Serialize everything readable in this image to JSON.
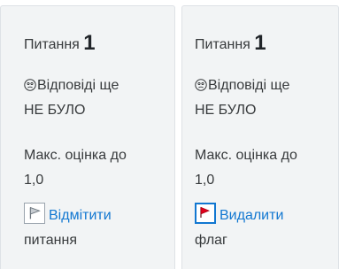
{
  "cards": [
    {
      "title_prefix": "Питання",
      "number": "1",
      "status_line1": "Відповіді ще",
      "status_line2": "НЕ БУЛО",
      "grade_line1": "Макс. оцінка до",
      "grade_line2": "1,0",
      "flag_line1": "Відмітити",
      "flag_line2": "питання",
      "flag_icon": "flag-outline-icon"
    },
    {
      "title_prefix": "Питання",
      "number": "1",
      "status_line1": "Відповіді ще",
      "status_line2": "НЕ БУЛО",
      "grade_line1": "Макс. оцінка до",
      "grade_line2": "1,0",
      "flag_line1": "Видалити",
      "flag_line2": "флаг",
      "flag_icon": "flag-red-icon"
    }
  ],
  "colors": {
    "card_bg": "#f2f4f5",
    "text": "#373a3c",
    "link": "#1177d1",
    "flag_red": "#e0001b"
  }
}
